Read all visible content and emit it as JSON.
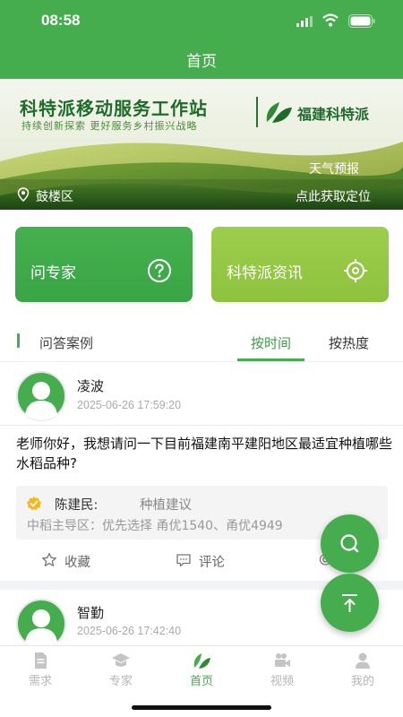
{
  "status_bar": {
    "time": "08:58"
  },
  "nav": {
    "title": "首页"
  },
  "banner": {
    "title": "科特派移动服务工作站",
    "subtitle": "持续创新探索 更好服务乡村振兴战略",
    "brand": "福建科特派",
    "weather_label": "天气预报",
    "district": "鼓楼区",
    "get_location": "点此获取定位"
  },
  "quick_cards": [
    {
      "label": "问专家",
      "icon": "question-circle-icon",
      "color": "#44b04f"
    },
    {
      "label": "科特派资讯",
      "icon": "target-icon",
      "color": "#96c946"
    }
  ],
  "section": {
    "title": "问答案例",
    "tabs": [
      {
        "label": "按时间",
        "active": true
      },
      {
        "label": "按热度",
        "active": false
      }
    ]
  },
  "posts": [
    {
      "user": "凌波",
      "time": "2025-06-26 17:59:20",
      "question": "老师你好，我想请问一下目前福建南平建阳地区最适宜种植哪些水稻品种?",
      "reply": {
        "expert": "陈建民:",
        "tag": "种植建议",
        "answer": "中稻主导区：优先选择 甬优1540、甬优4949"
      },
      "actions": {
        "favorite": "收藏",
        "comment": "评论",
        "share": "@"
      }
    },
    {
      "user": "智勤",
      "time": "2025-06-26 17:42:40"
    }
  ],
  "tabbar": [
    {
      "label": "需求",
      "icon": "document-icon",
      "active": false
    },
    {
      "label": "专家",
      "icon": "graduation-cap-icon",
      "active": false
    },
    {
      "label": "首页",
      "icon": "leaf-icon",
      "active": true
    },
    {
      "label": "视频",
      "icon": "video-camera-icon",
      "active": false
    },
    {
      "label": "我的",
      "icon": "user-icon",
      "active": false
    }
  ],
  "colors": {
    "primary": "#46ad4e",
    "secondary": "#96c946"
  }
}
